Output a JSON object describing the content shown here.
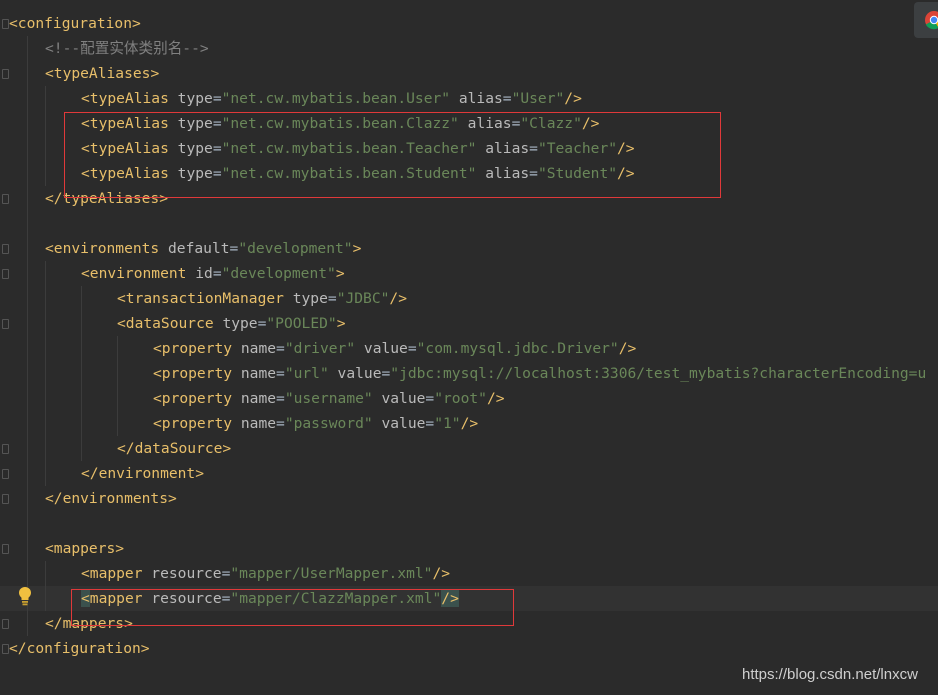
{
  "editor": {
    "lines": [
      {
        "tokens": [
          [
            "tag",
            "<configuration"
          ],
          [
            "tag",
            ">"
          ]
        ]
      },
      {
        "tokens": [
          [
            "comment",
            "<!--配置实体类别名-->"
          ]
        ]
      },
      {
        "tokens": [
          [
            "tag",
            "<typeAliases"
          ],
          [
            "tag",
            ">"
          ]
        ]
      },
      {
        "tokens": [
          [
            "tag",
            "<typeAlias "
          ],
          [
            "attr",
            "type"
          ],
          [
            "eq",
            "="
          ],
          [
            "val",
            "\"net.cw.mybatis.bean.User\""
          ],
          [
            "attr",
            " alias"
          ],
          [
            "eq",
            "="
          ],
          [
            "val",
            "\"User\""
          ],
          [
            "tag",
            "/>"
          ]
        ]
      },
      {
        "tokens": [
          [
            "tag",
            "<typeAlias "
          ],
          [
            "attr",
            "type"
          ],
          [
            "eq",
            "="
          ],
          [
            "val",
            "\"net.cw.mybatis.bean.Clazz\""
          ],
          [
            "attr",
            " alias"
          ],
          [
            "eq",
            "="
          ],
          [
            "val",
            "\"Clazz\""
          ],
          [
            "tag",
            "/>"
          ]
        ]
      },
      {
        "tokens": [
          [
            "tag",
            "<typeAlias "
          ],
          [
            "attr",
            "type"
          ],
          [
            "eq",
            "="
          ],
          [
            "val",
            "\"net.cw.mybatis.bean.Teacher\""
          ],
          [
            "attr",
            " alias"
          ],
          [
            "eq",
            "="
          ],
          [
            "val",
            "\"Teacher\""
          ],
          [
            "tag",
            "/>"
          ]
        ]
      },
      {
        "tokens": [
          [
            "tag",
            "<typeAlias "
          ],
          [
            "attr",
            "type"
          ],
          [
            "eq",
            "="
          ],
          [
            "val",
            "\"net.cw.mybatis.bean.Student\""
          ],
          [
            "attr",
            " alias"
          ],
          [
            "eq",
            "="
          ],
          [
            "val",
            "\"Student\""
          ],
          [
            "tag",
            "/>"
          ]
        ]
      },
      {
        "tokens": [
          [
            "tag",
            "</typeAliases>"
          ]
        ]
      },
      {
        "tokens": []
      },
      {
        "tokens": [
          [
            "tag",
            "<environments "
          ],
          [
            "attr",
            "default"
          ],
          [
            "eq",
            "="
          ],
          [
            "val",
            "\"development\""
          ],
          [
            "tag",
            ">"
          ]
        ]
      },
      {
        "tokens": [
          [
            "tag",
            "<environment "
          ],
          [
            "attr",
            "id"
          ],
          [
            "eq",
            "="
          ],
          [
            "val",
            "\"development\""
          ],
          [
            "tag",
            ">"
          ]
        ]
      },
      {
        "tokens": [
          [
            "tag",
            "<transactionManager "
          ],
          [
            "attr",
            "type"
          ],
          [
            "eq",
            "="
          ],
          [
            "val",
            "\"JDBC\""
          ],
          [
            "tag",
            "/>"
          ]
        ]
      },
      {
        "tokens": [
          [
            "tag",
            "<dataSource "
          ],
          [
            "attr",
            "type"
          ],
          [
            "eq",
            "="
          ],
          [
            "val",
            "\"POOLED\""
          ],
          [
            "tag",
            ">"
          ]
        ]
      },
      {
        "tokens": [
          [
            "tag",
            "<property "
          ],
          [
            "attr",
            "name"
          ],
          [
            "eq",
            "="
          ],
          [
            "val",
            "\"driver\""
          ],
          [
            "attr",
            " value"
          ],
          [
            "eq",
            "="
          ],
          [
            "val",
            "\"com.mysql.jdbc.Driver\""
          ],
          [
            "tag",
            "/>"
          ]
        ]
      },
      {
        "tokens": [
          [
            "tag",
            "<property "
          ],
          [
            "attr",
            "name"
          ],
          [
            "eq",
            "="
          ],
          [
            "val",
            "\"url\""
          ],
          [
            "attr",
            " value"
          ],
          [
            "eq",
            "="
          ],
          [
            "val",
            "\"jdbc:mysql://localhost:3306/test_mybatis?characterEncoding=u"
          ]
        ]
      },
      {
        "tokens": [
          [
            "tag",
            "<property "
          ],
          [
            "attr",
            "name"
          ],
          [
            "eq",
            "="
          ],
          [
            "val",
            "\"username\""
          ],
          [
            "attr",
            " value"
          ],
          [
            "eq",
            "="
          ],
          [
            "val",
            "\"root\""
          ],
          [
            "tag",
            "/>"
          ]
        ]
      },
      {
        "tokens": [
          [
            "tag",
            "<property "
          ],
          [
            "attr",
            "name"
          ],
          [
            "eq",
            "="
          ],
          [
            "val",
            "\"password\""
          ],
          [
            "attr",
            " value"
          ],
          [
            "eq",
            "="
          ],
          [
            "val",
            "\"1\""
          ],
          [
            "tag",
            "/>"
          ]
        ]
      },
      {
        "tokens": [
          [
            "tag",
            "</dataSource>"
          ]
        ]
      },
      {
        "tokens": [
          [
            "tag",
            "</environment>"
          ]
        ]
      },
      {
        "tokens": [
          [
            "tag",
            "</environments>"
          ]
        ]
      },
      {
        "tokens": []
      },
      {
        "tokens": [
          [
            "tag",
            "<mappers>"
          ]
        ]
      },
      {
        "tokens": [
          [
            "tag",
            "<mapper "
          ],
          [
            "attr",
            "resource"
          ],
          [
            "eq",
            "="
          ],
          [
            "val",
            "\"mapper/UserMapper.xml\""
          ],
          [
            "tag",
            "/>"
          ]
        ]
      },
      {
        "tokens": [
          [
            "tag",
            "<"
          ],
          [
            "tag",
            "mapper "
          ],
          [
            "attr",
            "resource"
          ],
          [
            "eq",
            "="
          ],
          [
            "val",
            "\"mapper/ClazzMapper.xml\""
          ],
          [
            "tag",
            "/>"
          ]
        ]
      },
      {
        "tokens": [
          [
            "tag",
            "</mappers>"
          ]
        ]
      },
      {
        "tokens": [
          [
            "tag",
            "</configuration>"
          ]
        ]
      }
    ]
  },
  "watermark": {
    "text": "https://blog.csdn.net/lnxcw"
  },
  "colors": {
    "background": "#2b2b2b",
    "tag": "#e8bf6a",
    "attribute": "#bababa",
    "string": "#6a8759",
    "comment": "#808080",
    "annotation_box": "#e0393a"
  },
  "icons": {
    "gutter": "lightbulb-icon",
    "top_right": "chrome-icon"
  }
}
